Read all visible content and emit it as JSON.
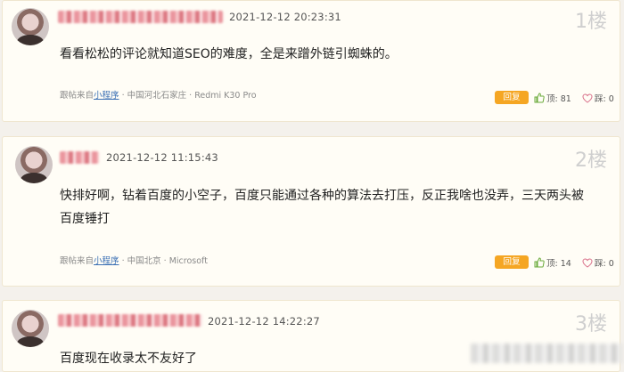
{
  "posts": [
    {
      "timestamp": "2021-12-12 20:23:31",
      "floor": "1楼",
      "content_lines": [
        "看看松松的评论就知道SEO的难度，全是来蹭外链引蜘蛛的。"
      ],
      "meta": {
        "prefix": "跟帖来自",
        "link": "小程序",
        "location": "· 中国河北石家庄 ·",
        "device": "Redmi K30 Pro"
      },
      "reply_label": "回复",
      "up_label": "顶: 81",
      "down_label": "踩: 0"
    },
    {
      "timestamp": "2021-12-12 11:15:43",
      "floor": "2楼",
      "content_lines": [
        "快排好啊，钻着百度的小空子，百度只能通过各种的算法去打压，反正我啥也没弄，三天两头被",
        "百度锤打"
      ],
      "meta": {
        "prefix": "跟帖来自",
        "link": "小程序",
        "location": "· 中国北京 ·",
        "device": "Microsoft"
      },
      "reply_label": "回复",
      "up_label": "顶: 14",
      "down_label": "踩: 0"
    },
    {
      "timestamp": "2021-12-12 14:22:27",
      "floor": "3楼",
      "content_lines": [
        "百度现在收录太不友好了"
      ]
    }
  ],
  "colors": {
    "accent": "#f5a623",
    "link": "#3a6fb4",
    "floor": "#cfcfcf"
  },
  "icons": {
    "up": "thumb-up-icon",
    "down": "heart-icon"
  }
}
